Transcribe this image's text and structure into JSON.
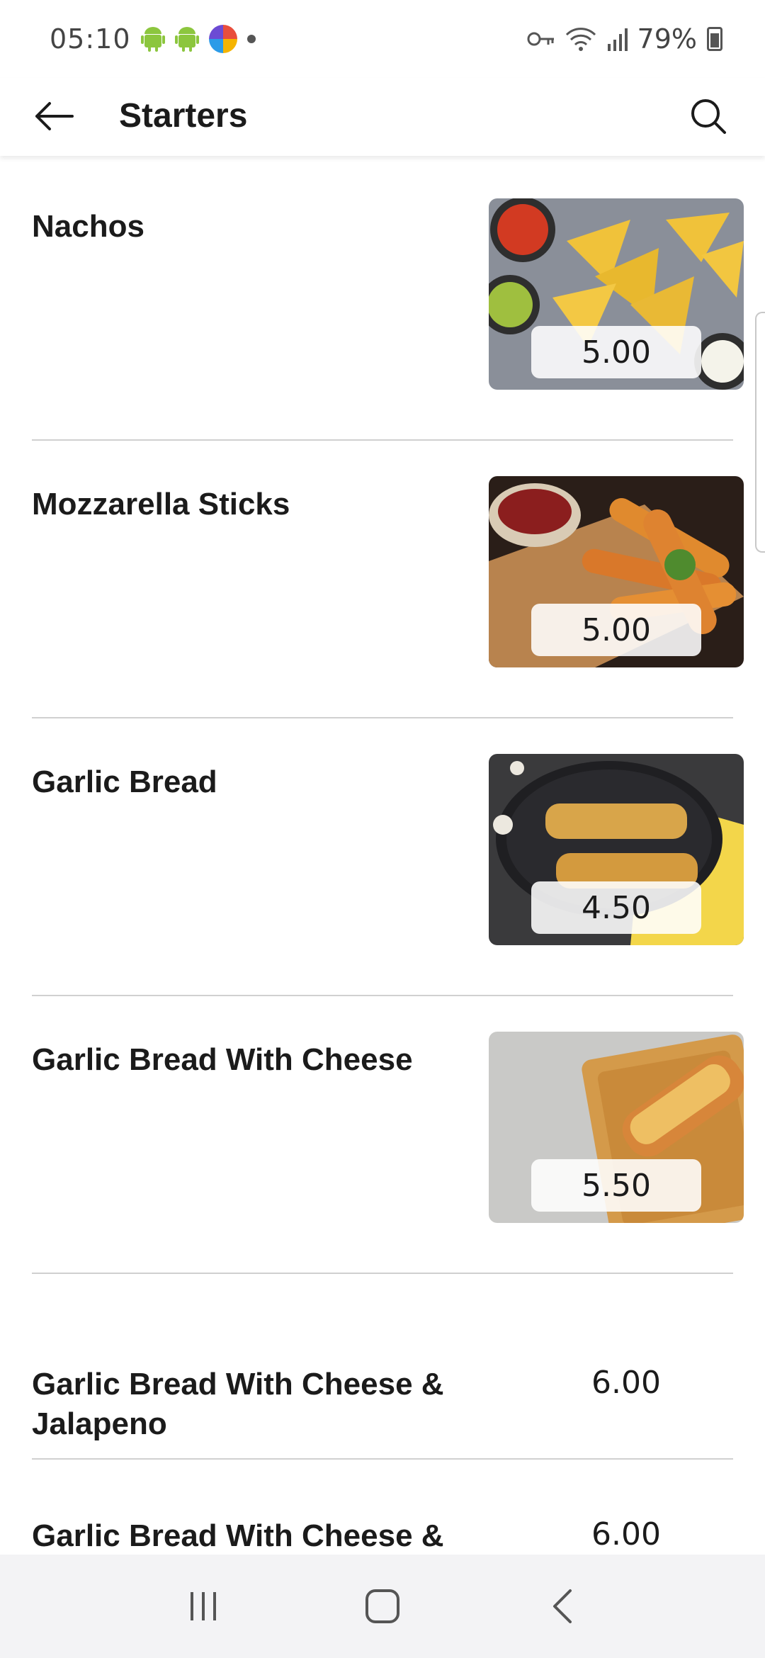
{
  "status_bar": {
    "time": "05:10",
    "battery": "79%",
    "icons": [
      "android-icon",
      "android-icon",
      "app-notification-icon",
      "dot-icon",
      "key-icon",
      "wifi-icon",
      "signal-icon",
      "battery-icon"
    ]
  },
  "app_bar": {
    "title": "Starters",
    "back_icon": "arrow-left-icon",
    "search_icon": "search-icon"
  },
  "items": [
    {
      "name": "Nachos",
      "price": "5.00"
    },
    {
      "name": "Mozzarella Sticks",
      "price": "5.00"
    },
    {
      "name": "Garlic Bread",
      "price": "4.50"
    },
    {
      "name": "Garlic Bread With Cheese",
      "price": "5.50"
    },
    {
      "name": "Garlic Bread With Cheese & Jalapeno",
      "price": "6.00"
    },
    {
      "name": "Garlic Bread With Cheese & Chilli",
      "price": "6.00"
    }
  ],
  "nav_bar": {
    "icons": [
      "recent-apps-icon",
      "home-icon",
      "back-icon"
    ]
  },
  "colors": {
    "background": "#ffffff",
    "text": "#1b1b1b",
    "divider": "#d0d0d0",
    "nav_bar": "#f3f3f5"
  }
}
